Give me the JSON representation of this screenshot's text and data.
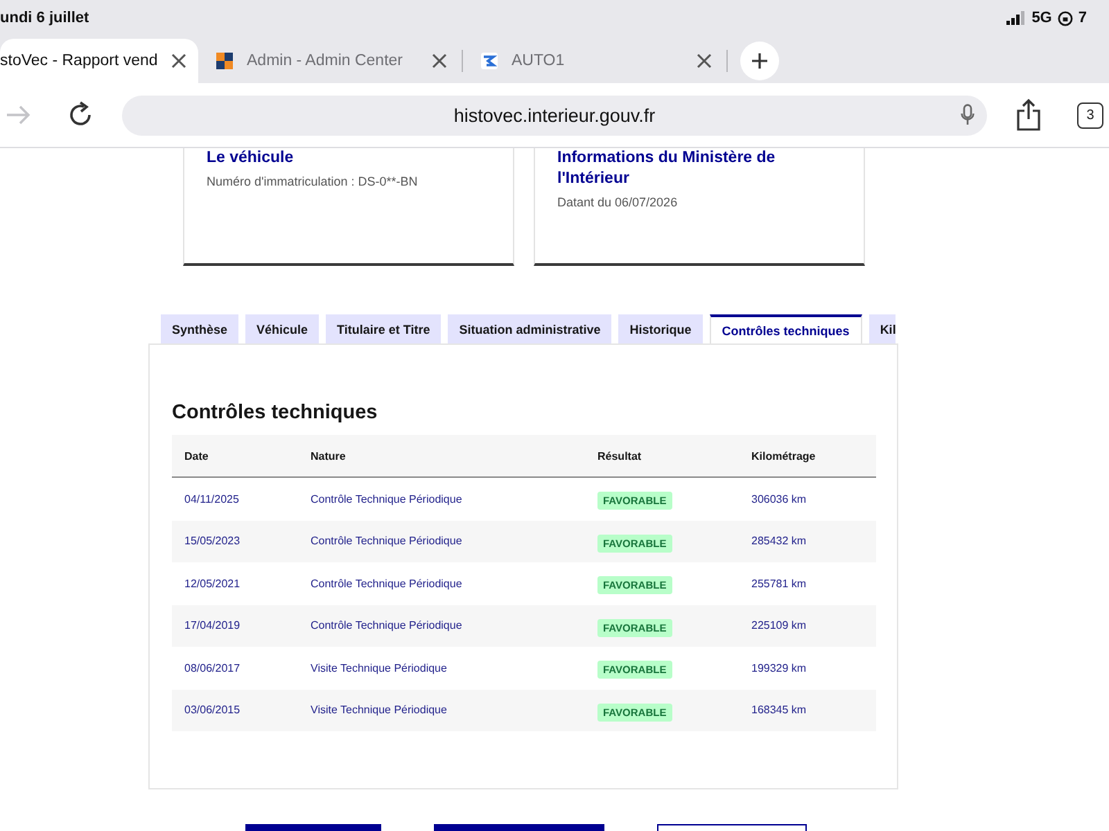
{
  "status_bar": {
    "date": "undi 6 juillet",
    "network": "5G",
    "battery": "7"
  },
  "browser_tabs": [
    {
      "title": "stoVec - Rapport vend",
      "kind": "plain",
      "selected": true
    },
    {
      "title": "Admin - Admin Center",
      "kind": "squares",
      "selected": false
    },
    {
      "title": "AUTO1",
      "kind": "logo",
      "selected": false
    }
  ],
  "toolbar": {
    "forward_disabled": true,
    "url": "histovec.interieur.gouv.fr",
    "tab_count": "3"
  },
  "cards": [
    {
      "title": "Le véhicule",
      "text": "Numéro d'immatriculation : DS-0**-BN"
    },
    {
      "title": "Informations du Ministère de l'Intérieur",
      "text": "Datant du 06/07/2026"
    }
  ],
  "tabs": [
    {
      "label": "Synthèse",
      "selected": false
    },
    {
      "label": "Véhicule",
      "selected": false
    },
    {
      "label": "Titulaire et Titre",
      "selected": false
    },
    {
      "label": "Situation administrative",
      "selected": false
    },
    {
      "label": "Historique",
      "selected": false
    },
    {
      "label": "Contrôles techniques",
      "selected": true
    },
    {
      "label": "Kil",
      "selected": false
    }
  ],
  "panel": {
    "title": "Contrôles techniques",
    "table": {
      "columns": [
        "Date",
        "Nature",
        "Résultat",
        "Kilométrage"
      ],
      "rows": [
        {
          "date": "04/11/2025",
          "nature": "Contrôle Technique Périodique",
          "result": "FAVORABLE",
          "mileage": "306036 km"
        },
        {
          "date": "15/05/2023",
          "nature": "Contrôle Technique Périodique",
          "result": "FAVORABLE",
          "mileage": "285432 km"
        },
        {
          "date": "12/05/2021",
          "nature": "Contrôle Technique Périodique",
          "result": "FAVORABLE",
          "mileage": "255781 km"
        },
        {
          "date": "17/04/2019",
          "nature": "Contrôle Technique Périodique",
          "result": "FAVORABLE",
          "mileage": "225109 km"
        },
        {
          "date": "08/06/2017",
          "nature": "Visite Technique Périodique",
          "result": "FAVORABLE",
          "mileage": "199329 km"
        },
        {
          "date": "03/06/2015",
          "nature": "Visite Technique Périodique",
          "result": "FAVORABLE",
          "mileage": "168345 km"
        }
      ]
    }
  },
  "actions": [
    {
      "kind": "primary"
    },
    {
      "kind": "primary"
    },
    {
      "kind": "secondary"
    }
  ]
}
